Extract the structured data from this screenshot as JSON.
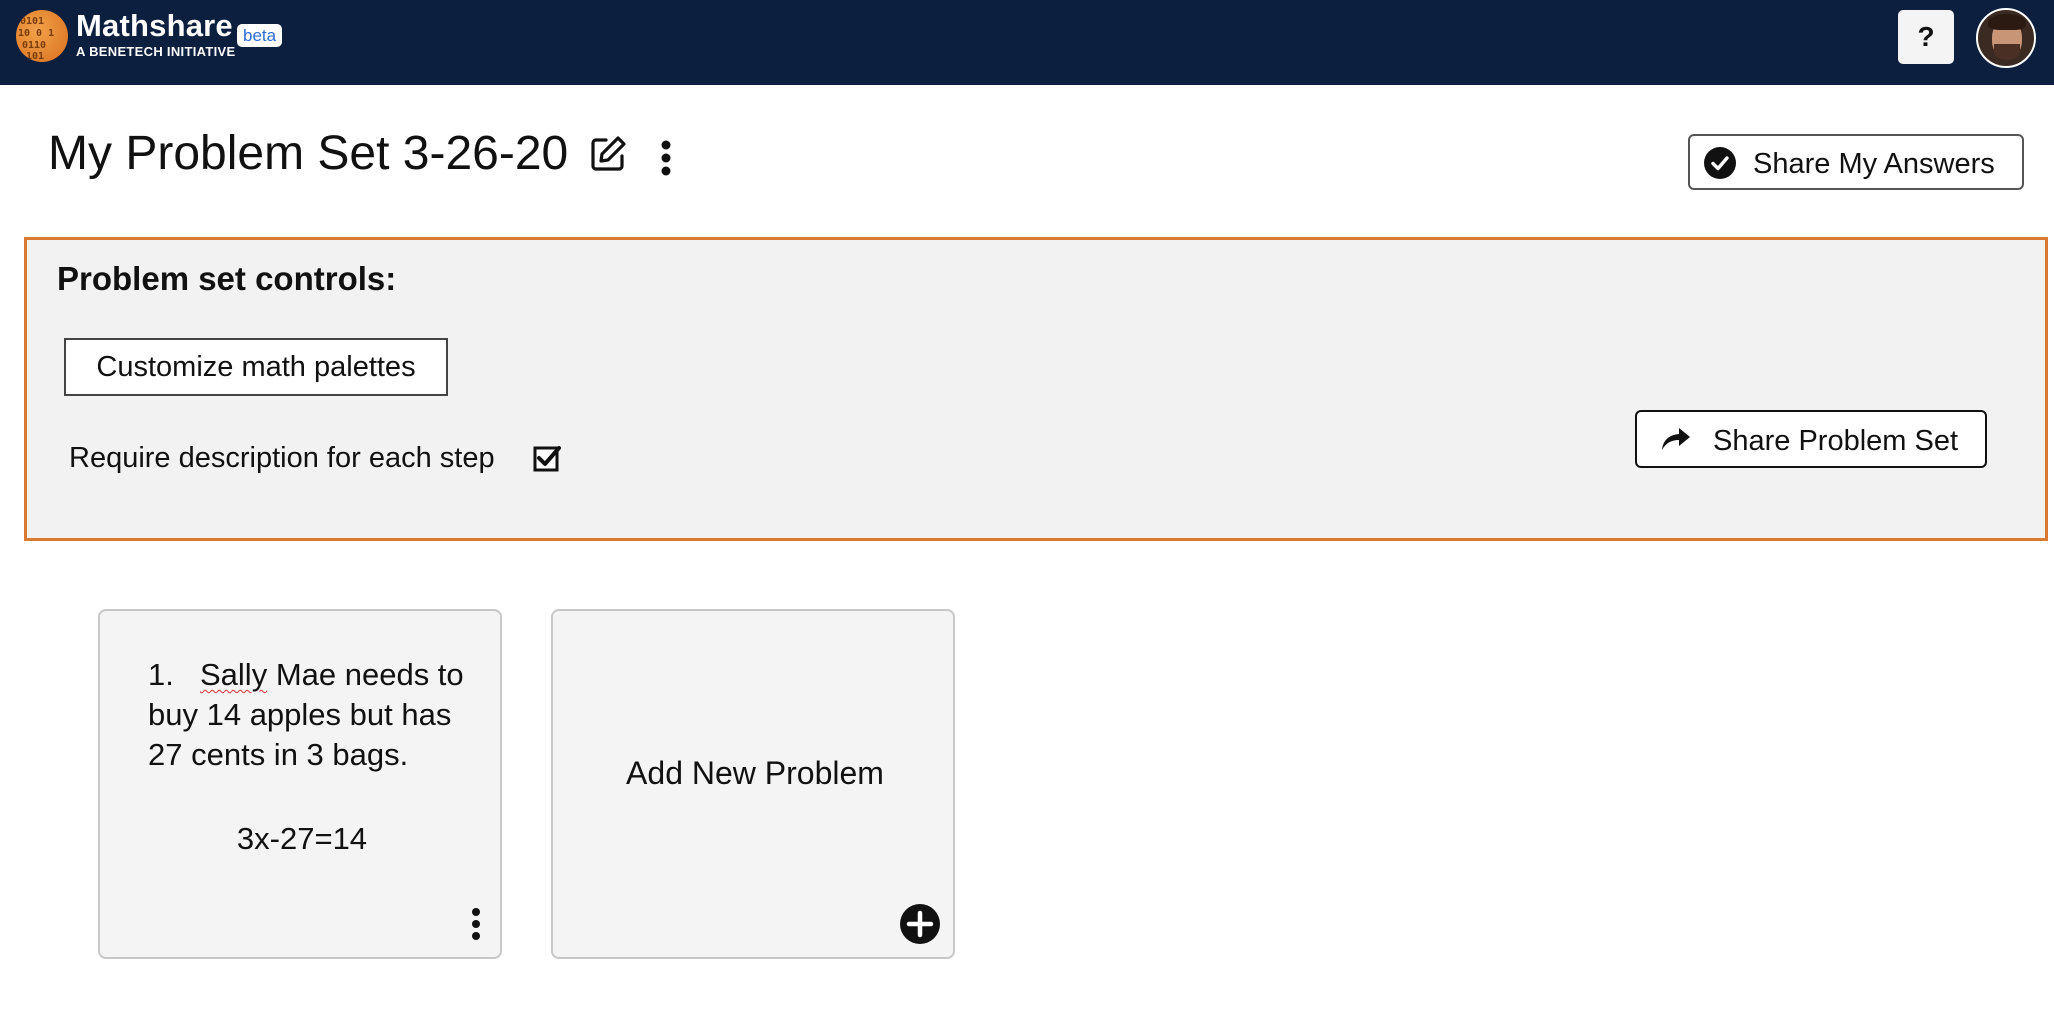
{
  "header": {
    "brand_name": "Mathshare",
    "brand_subtitle": "A BENETECH INITIATIVE",
    "beta_label": "beta",
    "help_label": "?",
    "logo_icon": "mathshare-logo",
    "avatar_icon": "user-avatar"
  },
  "title_row": {
    "title": "My Problem Set 3-26-20",
    "edit_icon": "edit-icon",
    "menu_icon": "kebab-icon",
    "share_answers_label": "Share My Answers"
  },
  "controls": {
    "heading": "Problem set controls:",
    "customize_label": "Customize math palettes",
    "require_label": "Require description for each step",
    "require_checked": true,
    "share_set_label": "Share Problem Set",
    "border_color": "#d97a2e"
  },
  "problems": [
    {
      "number": "1.",
      "text_first_word": "Sally",
      "text_rest": " Mae needs to buy 14 apples but has 27 cents in 3 bags.",
      "equation": "3x-27=14"
    }
  ],
  "add_card": {
    "label": "Add New Problem",
    "icon": "plus-circle-icon"
  },
  "colors": {
    "nav_bg": "#0c1f3f",
    "accent_orange": "#d97a2e",
    "beta_text": "#2b6cd6"
  }
}
